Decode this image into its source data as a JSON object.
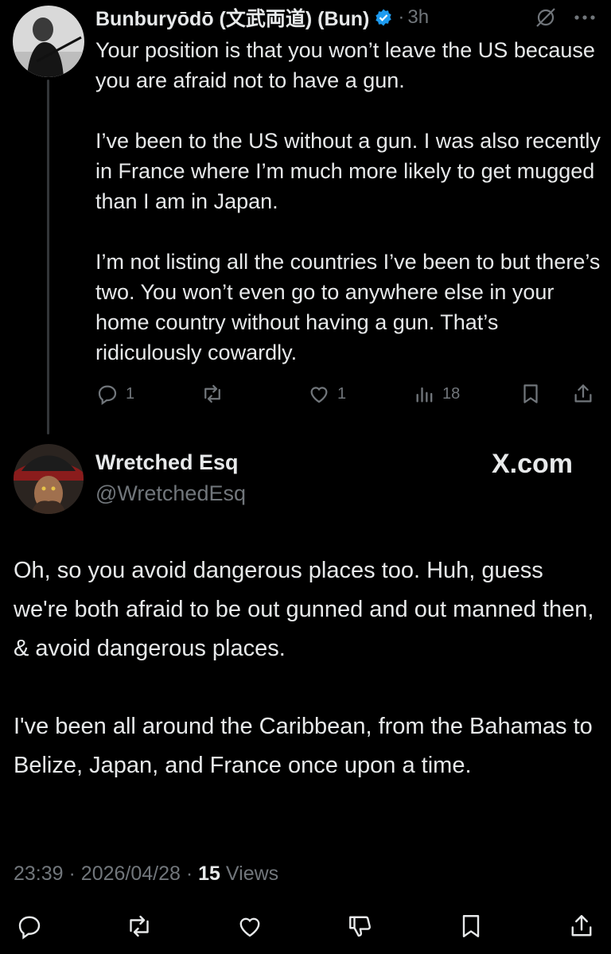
{
  "reply": {
    "author_name": "Bunburyōdō (文武両道) (Bun)",
    "separator": "·",
    "time": "3h",
    "paragraphs": [
      "Your position is that you won’t leave the US because you are afraid not to have a gun.",
      "I’ve been to the US without a gun. I was also recently in France where I’m much more likely to get mugged than I am in Japan.",
      "I’m not listing all the countries I’ve been to but there’s two. You won’t even go to anywhere else in your home country without having a gun. That’s ridiculously cowardly."
    ],
    "reply_count": "1",
    "like_count": "1",
    "view_count": "18"
  },
  "main": {
    "author_name": "Wretched Esq",
    "handle": "@WretchedEsq",
    "watermark": "X.com",
    "paragraphs": [
      "Oh, so you avoid dangerous places too. Huh, guess we're both afraid to be out gunned and out manned then, & avoid dangerous places.",
      "I've been all around the Caribbean, from the Bahamas to Belize, Japan, and France once upon a time."
    ],
    "time": "23:39",
    "dot": "·",
    "date": "2026/04/28",
    "views_count": "15",
    "views_label": "Views"
  },
  "icons": {
    "verified": "verified-badge-icon",
    "grok": "grok-icon",
    "more": "more-icon",
    "reply": "reply-icon",
    "retweet": "retweet-icon",
    "like": "like-icon",
    "views": "views-icon",
    "bookmark": "bookmark-icon",
    "share": "share-icon",
    "dislike": "dislike-icon"
  },
  "colors": {
    "background": "#000000",
    "text": "#e7e9ea",
    "muted": "#71767b",
    "verified": "#1d9bf0"
  }
}
